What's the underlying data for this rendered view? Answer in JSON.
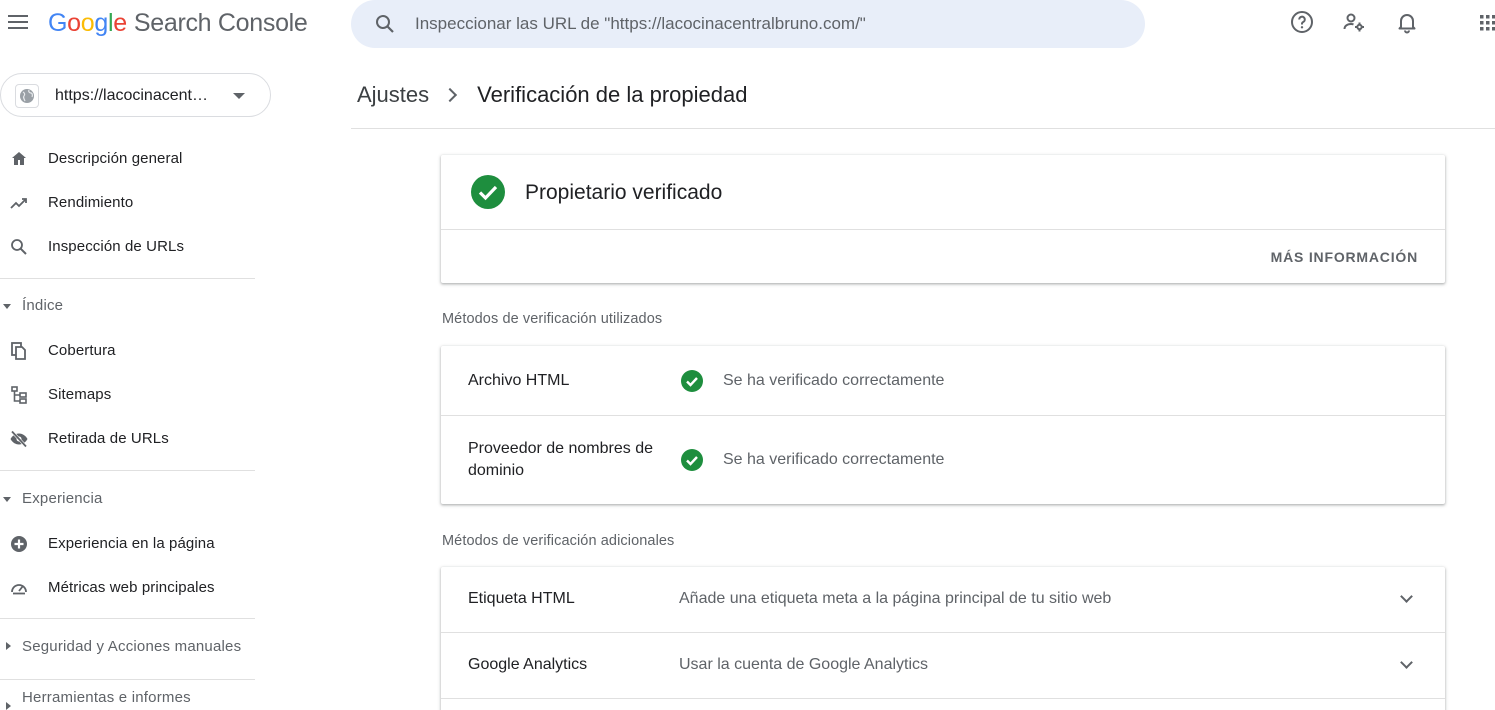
{
  "header": {
    "logo_letters": [
      "G",
      "o",
      "o",
      "g",
      "l",
      "e"
    ],
    "product_name": "Search Console",
    "search_placeholder": "Inspeccionar las URL de \"https://lacocinacentralbruno.com/\""
  },
  "icons": {
    "menu": "menu-icon",
    "search": "search-icon",
    "help": "help-icon",
    "user_settings": "manage-accounts-icon",
    "notifications": "bell-icon",
    "apps": "apps-grid-icon"
  },
  "sidebar": {
    "property_label": "https://lacocinacent…",
    "items_top": [
      {
        "label": "Descripción general",
        "icon": "home-icon"
      },
      {
        "label": "Rendimiento",
        "icon": "trending-up-icon"
      },
      {
        "label": "Inspección de URLs",
        "icon": "search-icon"
      }
    ],
    "section_index": "Índice",
    "items_index": [
      {
        "label": "Cobertura",
        "icon": "copy-icon"
      },
      {
        "label": "Sitemaps",
        "icon": "sitemap-icon"
      },
      {
        "label": "Retirada de URLs",
        "icon": "eye-off-icon"
      }
    ],
    "section_experience": "Experiencia",
    "items_experience": [
      {
        "label": "Experiencia en la página",
        "icon": "plus-circle-icon"
      },
      {
        "label": "Métricas web principales",
        "icon": "speed-icon"
      }
    ],
    "section_security": "Seguridad y Acciones manuales",
    "section_tools": "Herramientas e informes"
  },
  "main": {
    "breadcrumb": {
      "parent": "Ajustes",
      "current": "Verificación de la propiedad"
    },
    "owner_card": {
      "title": "Propietario verificado",
      "more_label": "MÁS INFORMACIÓN"
    },
    "used_methods_label": "Métodos de verificación utilizados",
    "used_methods": [
      {
        "name": "Archivo HTML",
        "status": "Se ha verificado correctamente"
      },
      {
        "name": "Proveedor de nombres de dominio",
        "status": "Se ha verificado correctamente"
      }
    ],
    "additional_methods_label": "Métodos de verificación adicionales",
    "additional_methods": [
      {
        "name": "Etiqueta HTML",
        "description": "Añade una etiqueta meta a la página principal de tu sitio web"
      },
      {
        "name": "Google Analytics",
        "description": "Usar la cuenta de Google Analytics"
      }
    ]
  },
  "colors": {
    "success_green": "#1e8e3e",
    "search_bg": "#e8eef9",
    "text_primary": "#202124",
    "text_secondary": "#5f6368"
  }
}
